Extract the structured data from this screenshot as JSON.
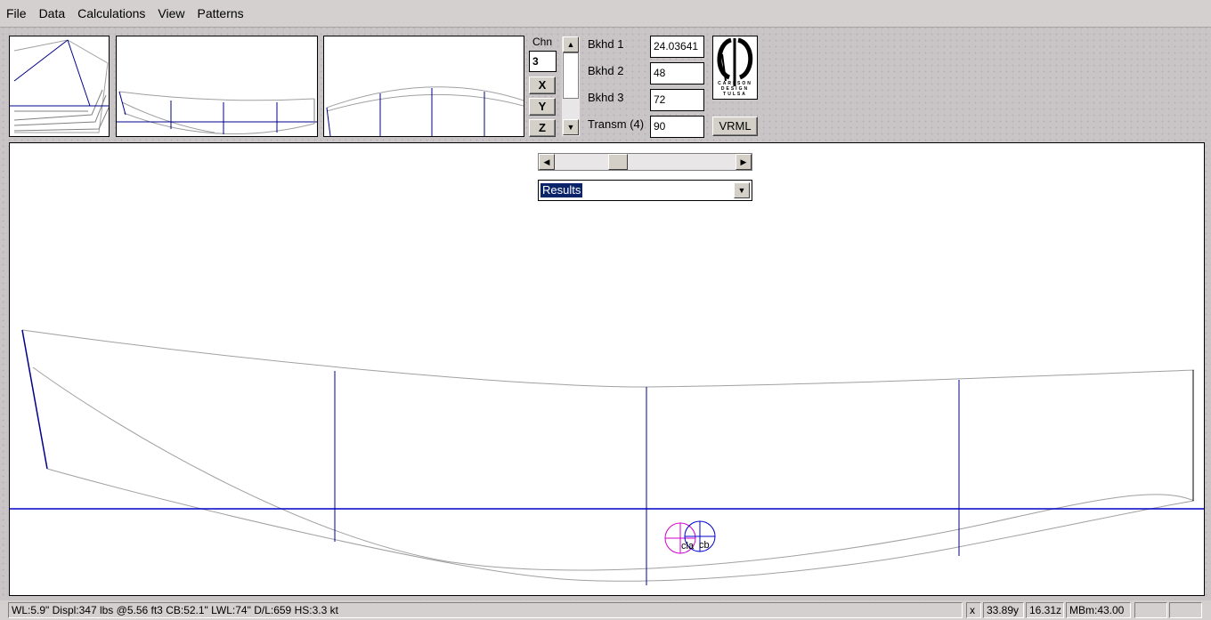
{
  "menu": [
    "File",
    "Data",
    "Calculations",
    "View",
    "Patterns"
  ],
  "controls": {
    "chine_label": "Chn",
    "chine_value": "3",
    "axis_buttons": [
      "X",
      "Y",
      "Z"
    ],
    "bulkheads": [
      {
        "label": "Bkhd 1",
        "value": "24.03641"
      },
      {
        "label": "Bkhd 2",
        "value": "48"
      },
      {
        "label": "Bkhd 3",
        "value": "72"
      },
      {
        "label": "Transm (4)",
        "value": "90"
      }
    ],
    "vrml_label": "VRML",
    "logo_text": "CARLSON DESIGN TULSA"
  },
  "main": {
    "slider_value_fraction": 0.33,
    "results_select": "Results",
    "markers": {
      "cla": "cla",
      "cb": "cb"
    }
  },
  "status": {
    "summary": "WL:5.9\"  Displ:347 lbs @5.56 ft3  CB:52.1\"  LWL:74\"  D/L:659  HS:3.3 kt",
    "x": "x",
    "y": "33.89y",
    "z": "16.31z",
    "mbm": "MBm:43.00"
  },
  "colors": {
    "line": "#00008b",
    "hull": "#a0a0a0",
    "cla": "#cc00cc",
    "cb": "#0000cc"
  }
}
